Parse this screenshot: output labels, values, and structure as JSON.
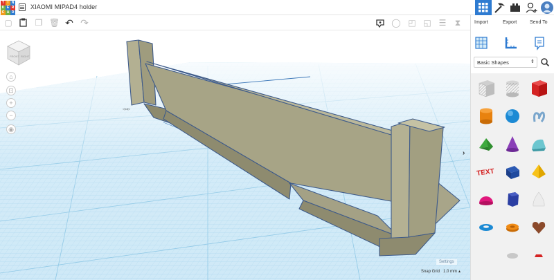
{
  "app": {
    "logo_letters": [
      "TIN",
      "KER",
      "CAD"
    ],
    "logo_colors": [
      "#e2352a",
      "#f39c1f",
      "#2e7bd1",
      "#74b144",
      "#2e7bd1",
      "#e2352a",
      "#f39c1f",
      "#74b144",
      "#2e7bd1"
    ],
    "doc_title": "XIAOMI MIPAD4 holder"
  },
  "header": {
    "actions": [
      "Import",
      "Export",
      "Send To"
    ]
  },
  "panel": {
    "shape_category": "Basic Shapes",
    "shapes": [
      "box-hole",
      "cylinder-hole",
      "box",
      "cylinder",
      "sphere",
      "scribble",
      "roof",
      "cone",
      "round-roof",
      "text",
      "cube",
      "pyramid",
      "half-sphere",
      "polygon",
      "paraboloid",
      "torus",
      "tube",
      "heart"
    ]
  },
  "viewport": {
    "settings_label": "Settings",
    "snap_label": "Snap Grid",
    "snap_value": "1.0 mm"
  },
  "colors": {
    "accent": "#2e7bd1",
    "grid_base": "#cfe9f7",
    "grid_line": "#9fd1ec",
    "model_face": "#a5a283",
    "model_edge": "#3d5a8a"
  }
}
